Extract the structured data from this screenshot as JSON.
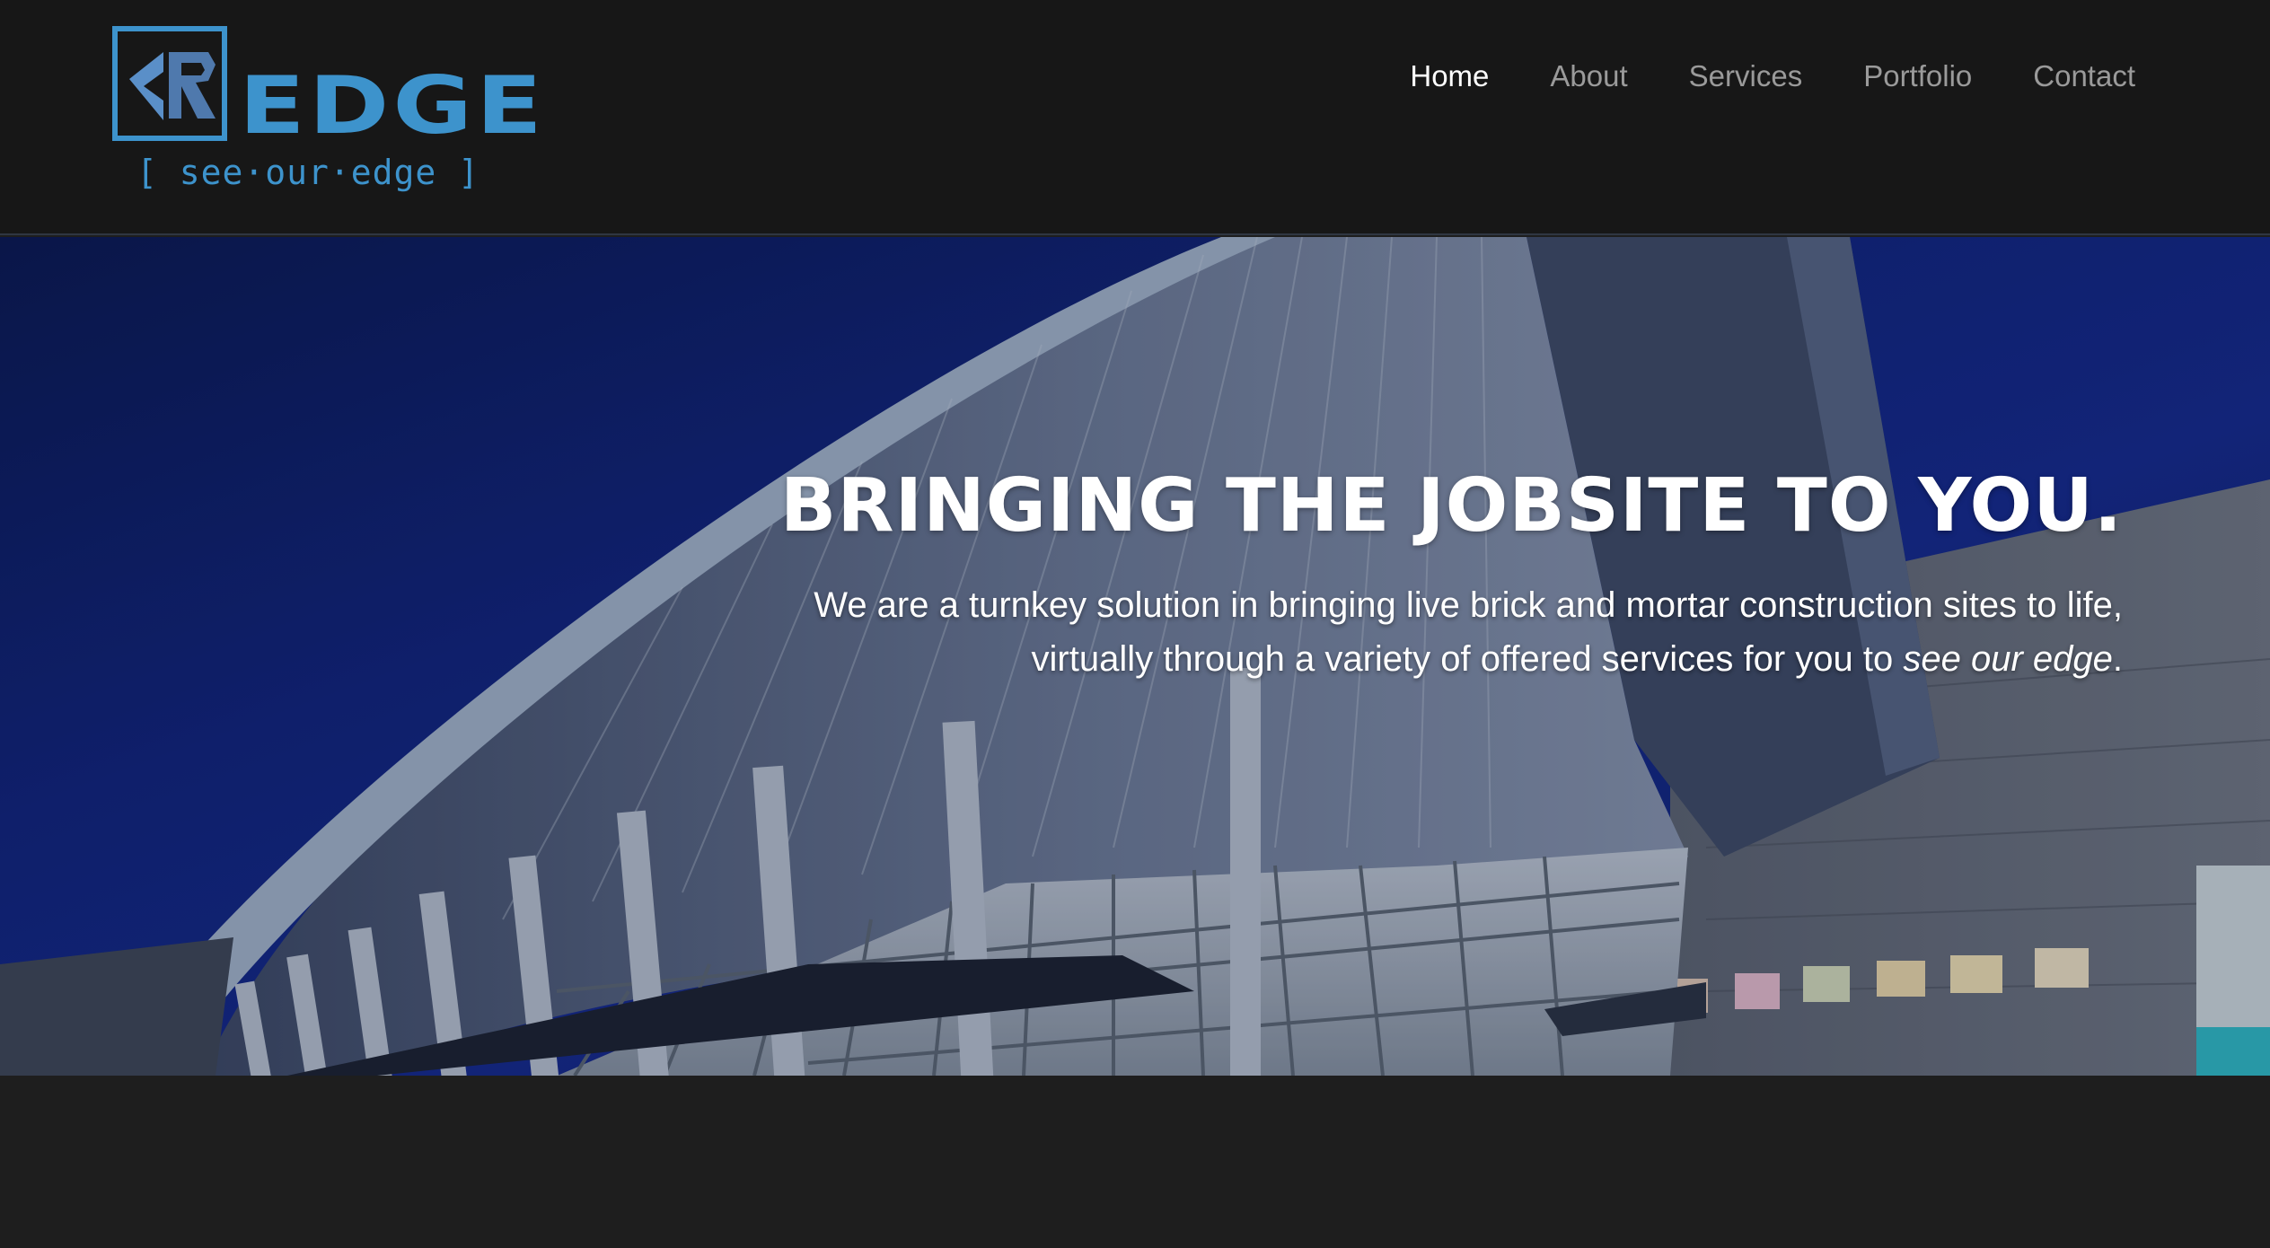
{
  "logo": {
    "monogram": "CR",
    "wordmark": "EDGE",
    "tagline": "[ see·our·edge ]"
  },
  "nav": {
    "items": [
      {
        "label": "Home",
        "active": true
      },
      {
        "label": "About",
        "active": false
      },
      {
        "label": "Services",
        "active": false
      },
      {
        "label": "Portfolio",
        "active": false
      },
      {
        "label": "Contact",
        "active": false
      }
    ]
  },
  "hero": {
    "title": "BRINGING THE JOBSITE TO YOU.",
    "text_line1": "We are a turnkey solution in bringing live brick and mortar construction sites to life,",
    "text_line2_prefix": "virtually through a variety of offered services for you to ",
    "text_line2_emphasis": "see our edge",
    "text_line2_suffix": ".",
    "background_image": "modern-building-night-photo"
  },
  "colors": {
    "header_bg": "#171717",
    "page_bg": "#1e1e1e",
    "brand_blue": "#3d93cc",
    "nav_active": "#ffffff",
    "nav_inactive": "#9a9a9a",
    "sky": "#10237a"
  }
}
